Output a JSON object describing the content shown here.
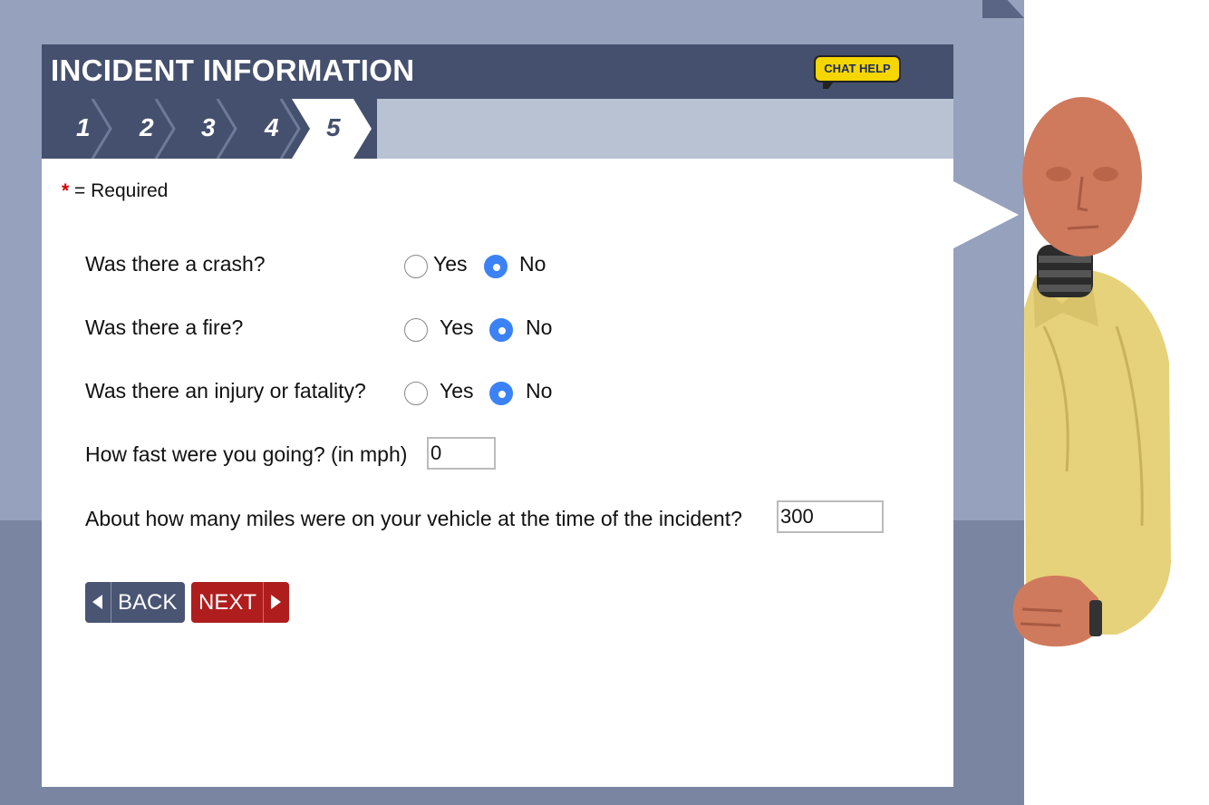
{
  "header": {
    "title": "INCIDENT INFORMATION",
    "chat_help": "CHAT HELP"
  },
  "steps": [
    "1",
    "2",
    "3",
    "4",
    "5"
  ],
  "active_step": "5",
  "required_note": {
    "star": "*",
    "text": "= Required"
  },
  "questions": {
    "crash": {
      "label": "Was there a crash?",
      "yes": "Yes",
      "no": "No",
      "selected": "No"
    },
    "fire": {
      "label": "Was there a fire?",
      "yes": "Yes",
      "no": "No",
      "selected": "No"
    },
    "injury": {
      "label": "Was there an injury or fatality?",
      "yes": "Yes",
      "no": "No",
      "selected": "No"
    },
    "speed": {
      "label": "How fast were you going? (in mph)",
      "value": "0"
    },
    "miles": {
      "label": "About how many miles were on your vehicle at the time of the incident?",
      "value": "300"
    }
  },
  "buttons": {
    "back": "BACK",
    "next": "NEXT"
  },
  "colors": {
    "header_bg": "#45506e",
    "accent_blue": "#3b82f6",
    "next_red": "#b01d1d",
    "chat_yellow": "#f5d600"
  }
}
